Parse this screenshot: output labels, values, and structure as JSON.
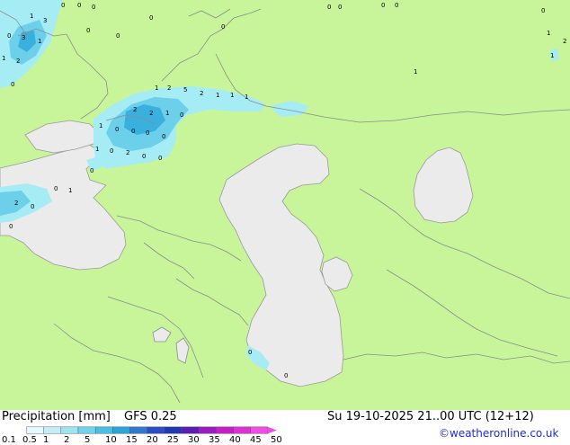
{
  "map": {
    "colors": {
      "land": "#c8f59a",
      "sea": "#ebebeb",
      "border": "#8c8c8c",
      "coast": "#9a9a9a",
      "precip_light": "#a6ecf4",
      "precip_mid": "#6dd0ea",
      "precip_heavy": "#3ab0de"
    },
    "values": [
      "1",
      "3",
      "3",
      "1",
      "0",
      "1",
      "2",
      "0",
      "0",
      "0",
      "0",
      "0",
      "0",
      "0",
      "0",
      "0",
      "0",
      "0",
      "0",
      "0",
      "1",
      "2",
      "1",
      "1",
      "1",
      "2",
      "5",
      "2",
      "1",
      "1",
      "1",
      "2",
      "2",
      "1",
      "0",
      "1",
      "0",
      "0",
      "0",
      "0",
      "1",
      "0",
      "2",
      "0",
      "0",
      "0",
      "0"
    ]
  },
  "footer": {
    "title": "Precipitation [mm]",
    "model": "GFS 0.25",
    "valid": "Su 19-10-2025 21..00 UTC (12+12)",
    "credit": "©weatheronline.co.uk"
  },
  "scale": {
    "labels": [
      "0.1",
      "0.5",
      "1",
      "2",
      "5",
      "10",
      "15",
      "20",
      "25",
      "30",
      "35",
      "40",
      "45",
      "50"
    ],
    "colors": [
      "#e6f7ff",
      "#c3eef8",
      "#9de3f2",
      "#6fd3ec",
      "#46bfe3",
      "#2aa4d8",
      "#2f78cf",
      "#2a4fc4",
      "#2238b0",
      "#5a1cb4",
      "#9a1bc4",
      "#c81dc8",
      "#de2fd6",
      "#f04be2"
    ]
  }
}
